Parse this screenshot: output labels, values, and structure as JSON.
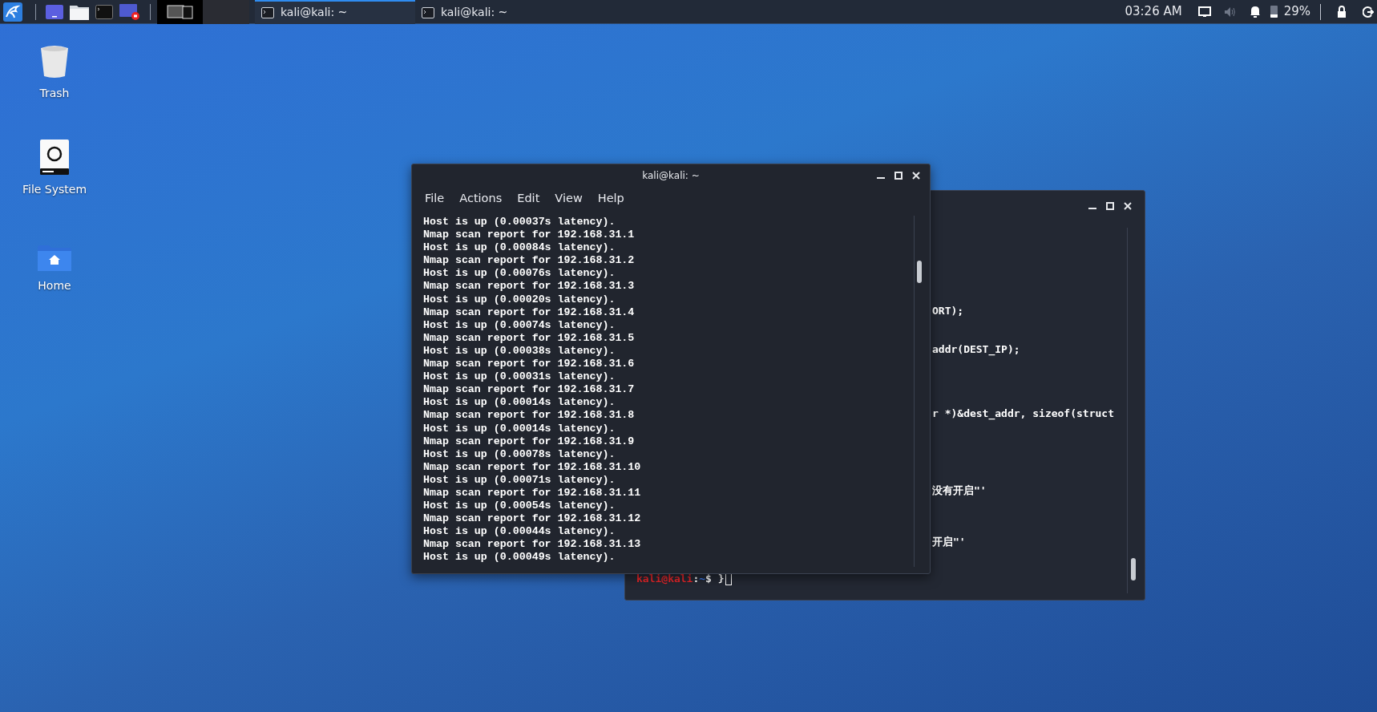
{
  "panel": {
    "taskbar": [
      {
        "title": "kali@kali: ~",
        "selected": true
      },
      {
        "title": "kali@kali: ~",
        "selected": false
      }
    ],
    "clock": "03:26 AM",
    "volume": {
      "muted": true
    },
    "battery": {
      "text": "29%",
      "level": 0.29
    }
  },
  "desktop_icons": [
    {
      "kind": "trash",
      "label": "Trash"
    },
    {
      "kind": "drive",
      "label": "File System"
    },
    {
      "kind": "home",
      "label": "Home"
    }
  ],
  "back_terminal": {
    "fragments": [
      "ORT);",
      "addr(DEST_IP);",
      "r *)&dest_addr, sizeof(struct",
      "没有开启\"'",
      "开启\"'"
    ],
    "prompt": {
      "user_host": "kali@kali",
      "separator": ":",
      "path": "~",
      "symbol": "$",
      "input": "}"
    }
  },
  "front_terminal": {
    "title": "kali@kali: ~",
    "menu": [
      "File",
      "Actions",
      "Edit",
      "View",
      "Help"
    ],
    "lines": [
      "Host is up (0.00037s latency).",
      "Nmap scan report for 192.168.31.1",
      "Host is up (0.00084s latency).",
      "Nmap scan report for 192.168.31.2",
      "Host is up (0.00076s latency).",
      "Nmap scan report for 192.168.31.3",
      "Host is up (0.00020s latency).",
      "Nmap scan report for 192.168.31.4",
      "Host is up (0.00074s latency).",
      "Nmap scan report for 192.168.31.5",
      "Host is up (0.00038s latency).",
      "Nmap scan report for 192.168.31.6",
      "Host is up (0.00031s latency).",
      "Nmap scan report for 192.168.31.7",
      "Host is up (0.00014s latency).",
      "Nmap scan report for 192.168.31.8",
      "Host is up (0.00014s latency).",
      "Nmap scan report for 192.168.31.9",
      "Host is up (0.00078s latency).",
      "Nmap scan report for 192.168.31.10",
      "Host is up (0.00071s latency).",
      "Nmap scan report for 192.168.31.11",
      "Host is up (0.00054s latency).",
      "Nmap scan report for 192.168.31.12",
      "Host is up (0.00044s latency).",
      "Nmap scan report for 192.168.31.13",
      "Host is up (0.00049s latency)."
    ]
  }
}
